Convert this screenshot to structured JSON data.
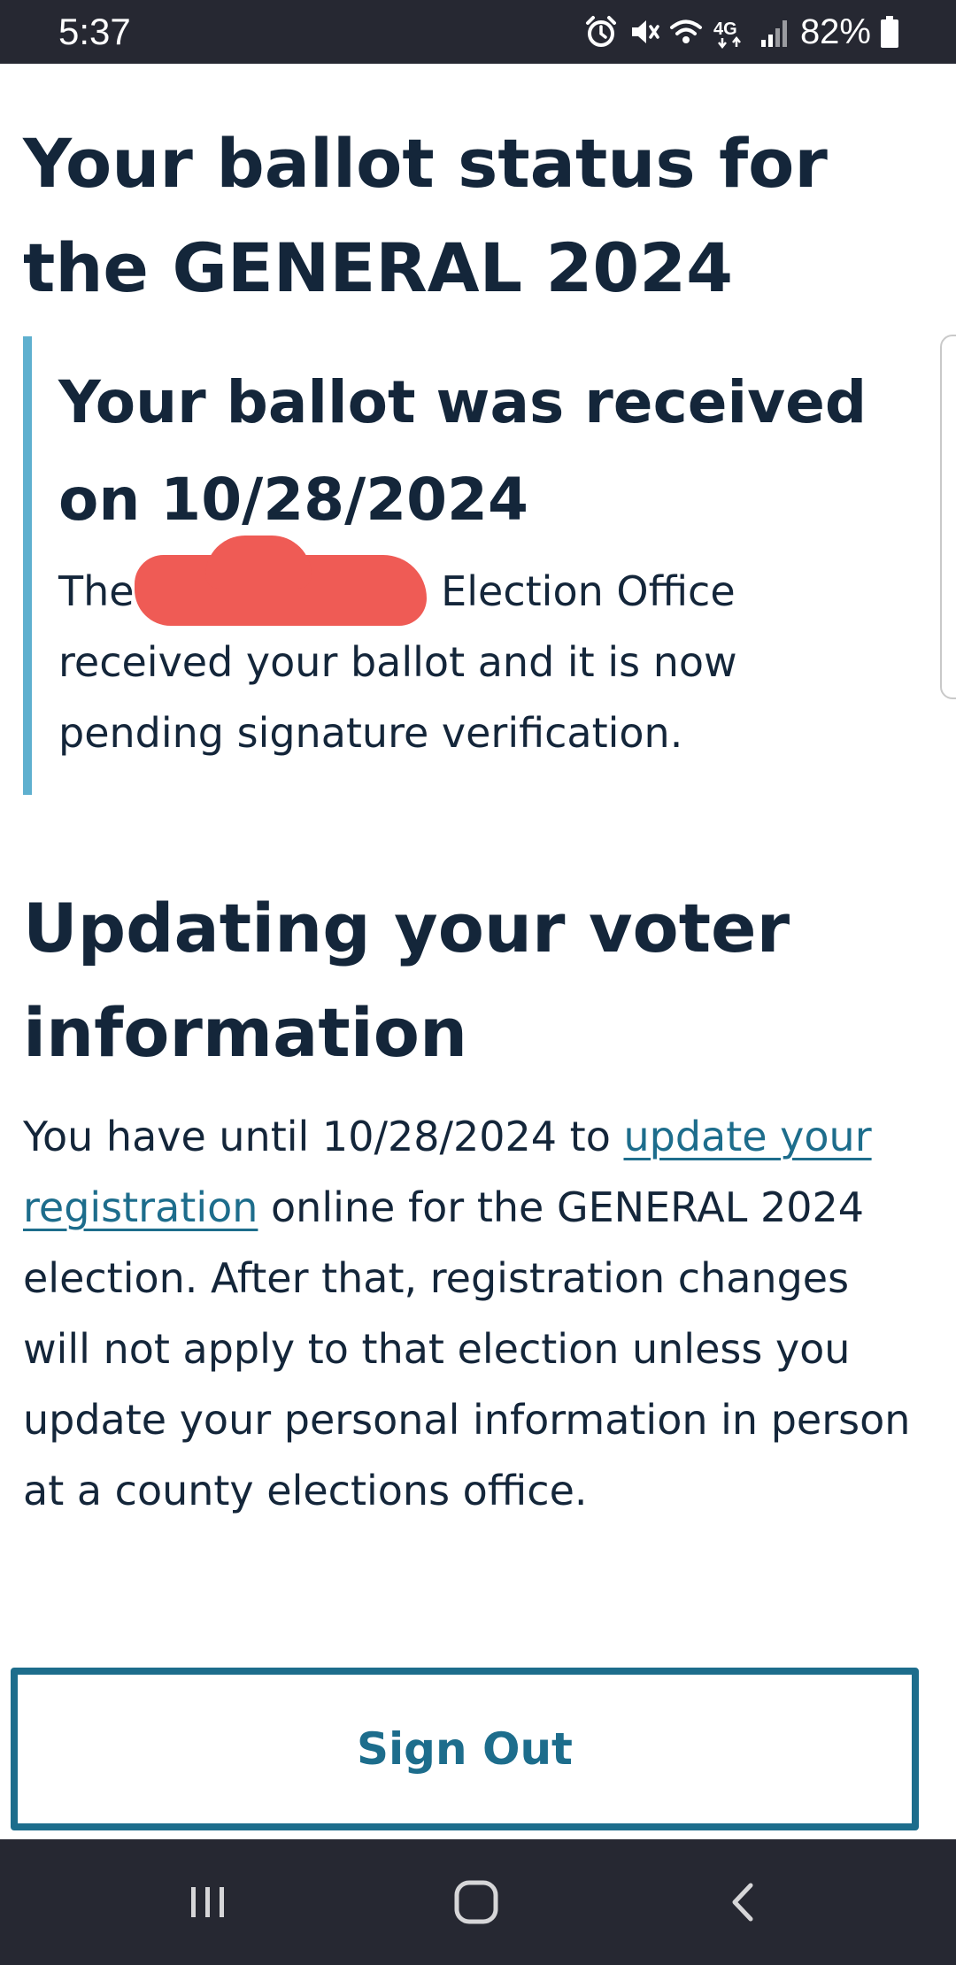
{
  "status_bar": {
    "time": "5:37",
    "battery_percent": "82%",
    "network_label": "4G",
    "icons": [
      "alarm-icon",
      "mute-icon",
      "wifi-icon",
      "network-4g-icon",
      "signal-icon",
      "battery-icon"
    ]
  },
  "ballot_status": {
    "title": "Your ballot status for the GENERAL 2024",
    "callout": {
      "heading": "Your ballot was received on 10/28/2024",
      "body_prefix": "The",
      "body_suffix": " Election Office received your ballot and it is now pending signature verification."
    }
  },
  "voter_info": {
    "heading": "Updating your voter information",
    "body_before_link": "You have until 10/28/2024 to ",
    "link_text": "update your registration",
    "body_after_link": " online for the GENERAL 2024 election. After that, registration changes will not apply to that election unless you update your personal information in person at a county elections office."
  },
  "actions": {
    "sign_out_label": "Sign Out"
  },
  "colors": {
    "heading_text": "#14263a",
    "accent_blue": "#1d6d8c",
    "callout_border": "#5fb0cf",
    "redaction": "#ef5b55",
    "system_bar": "#262832"
  },
  "nav_bar": {
    "buttons": [
      "recent-apps-icon",
      "home-icon",
      "back-icon"
    ]
  }
}
